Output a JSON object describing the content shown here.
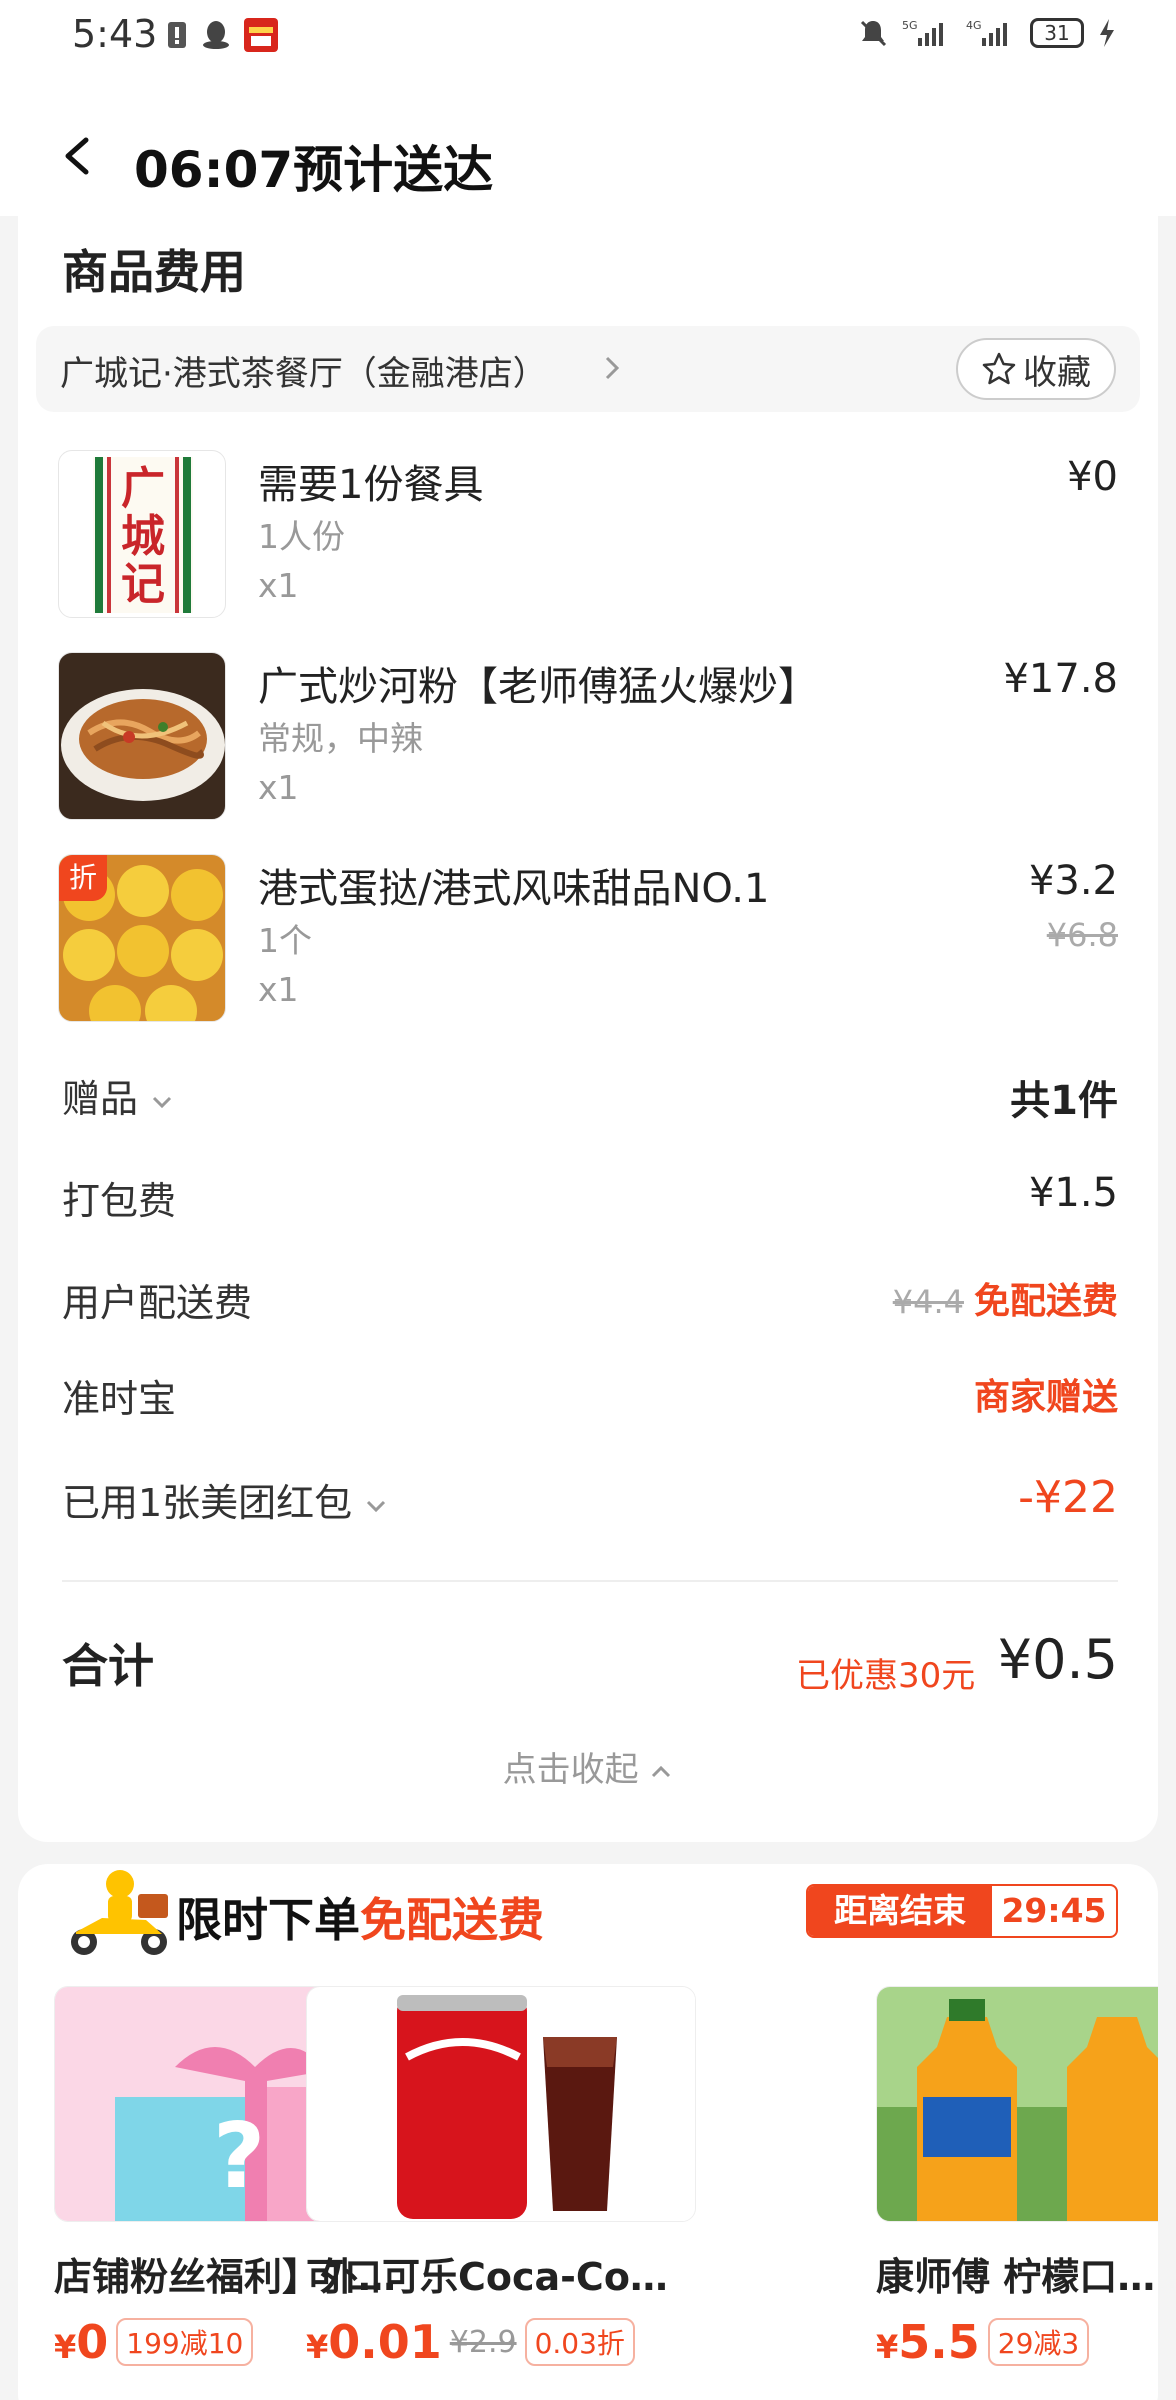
{
  "status_bar": {
    "time": "5:43",
    "battery": "31"
  },
  "header": {
    "title": "06:07预计送达"
  },
  "section_title": "商品费用",
  "shop": {
    "name": "广城记·港式茶餐厅（金融港店）",
    "favorite_label": "收藏"
  },
  "items": [
    {
      "name": "需要1份餐具",
      "spec": "1人份",
      "qty": "x1",
      "price": "¥0",
      "thumb_text": "广城记"
    },
    {
      "name": "广式炒河粉【老师傅猛火爆炒】",
      "spec": "常规，中辣",
      "qty": "x1",
      "price": "¥17.8"
    },
    {
      "name": "港式蛋挞/港式风味甜品NO.1",
      "spec": "1个",
      "qty": "x1",
      "price": "¥3.2",
      "original_price": "¥6.8",
      "tag": "折"
    }
  ],
  "fees": {
    "gift": {
      "label": "赠品",
      "value": "共1件"
    },
    "packing": {
      "label": "打包费",
      "value": "¥1.5"
    },
    "delivery": {
      "label": "用户配送费",
      "original": "¥4.4",
      "value": "免配送费"
    },
    "ontime": {
      "label": "准时宝",
      "value": "商家赠送"
    },
    "coupon": {
      "label": "已用1张美团红包",
      "value": "-¥22"
    }
  },
  "total": {
    "label": "合计",
    "saved": "已优惠30元",
    "value": "¥0.5"
  },
  "collapse_label": "点击收起",
  "promo": {
    "title_prefix": "限时下单",
    "title_highlight": "免配送费",
    "countdown_label": "距离结束",
    "countdown_value": "29:45",
    "products": [
      {
        "name": "店铺粉丝福利】外…",
        "price": "0",
        "badge": "199减10"
      },
      {
        "name": "可口可乐Coca-Co…",
        "price": "0.01",
        "original": "¥2.9",
        "badge": "0.03折"
      },
      {
        "name": "康师傅 柠檬口味…",
        "price": "5.5",
        "badge": "29减3"
      }
    ]
  },
  "colors": {
    "accent": "#f0461e"
  }
}
